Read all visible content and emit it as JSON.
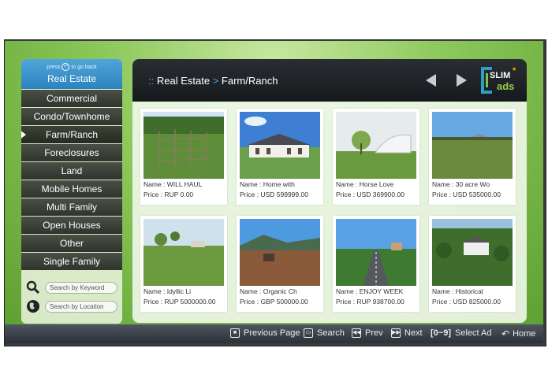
{
  "sidebar": {
    "hint_prefix": "press",
    "hint_suffix": "to go back",
    "title": "Real Estate",
    "categories": [
      "Commercial",
      "Condo/Townhome",
      "Farm/Ranch",
      "Foreclosures",
      "Land",
      "Mobile Homes",
      "Multi Family",
      "Open Houses",
      "Other",
      "Single Family"
    ],
    "active_category": "Farm/Ranch",
    "search_keyword": "Search by Keyword",
    "search_location": "Search by Location"
  },
  "header": {
    "crumb_dots": "::",
    "crumb_root": "Real Estate",
    "crumb_sep": ">",
    "crumb_current": "Farm/Ranch",
    "logo_text": "SLIM",
    "logo_sub": "ads",
    "logo_star": "*"
  },
  "listings": [
    {
      "name": "Name : WILL HAUL",
      "price": "Price : RUP 0.00"
    },
    {
      "name": "Name : Home with",
      "price": "Price : USD 599999.00"
    },
    {
      "name": "Name : Horse Love",
      "price": "Price : USD 369900.00"
    },
    {
      "name": "Name : 30 acre Wo",
      "price": "Price : USD 535000.00"
    },
    {
      "name": "Name : Idyllic Li",
      "price": "Price : RUP 5000000.00"
    },
    {
      "name": "Name : Organic Ch",
      "price": "Price : GBP 500000.00"
    },
    {
      "name": "Name : ENJOY WEEK",
      "price": "Price : RUP 938700.00"
    },
    {
      "name": "Name : Historical",
      "price": "Price : USD 825000.00"
    }
  ],
  "bottombar": {
    "previous_page": "Previous Page",
    "search": "Search",
    "prev": "Prev",
    "next": "Next",
    "select_keys": "[0~9]",
    "select_ad": "Select Ad",
    "home": "Home"
  },
  "colors": {
    "accent": "#2c82bf",
    "green_bg": "#8cc85a",
    "header_bg": "#1e2226"
  }
}
